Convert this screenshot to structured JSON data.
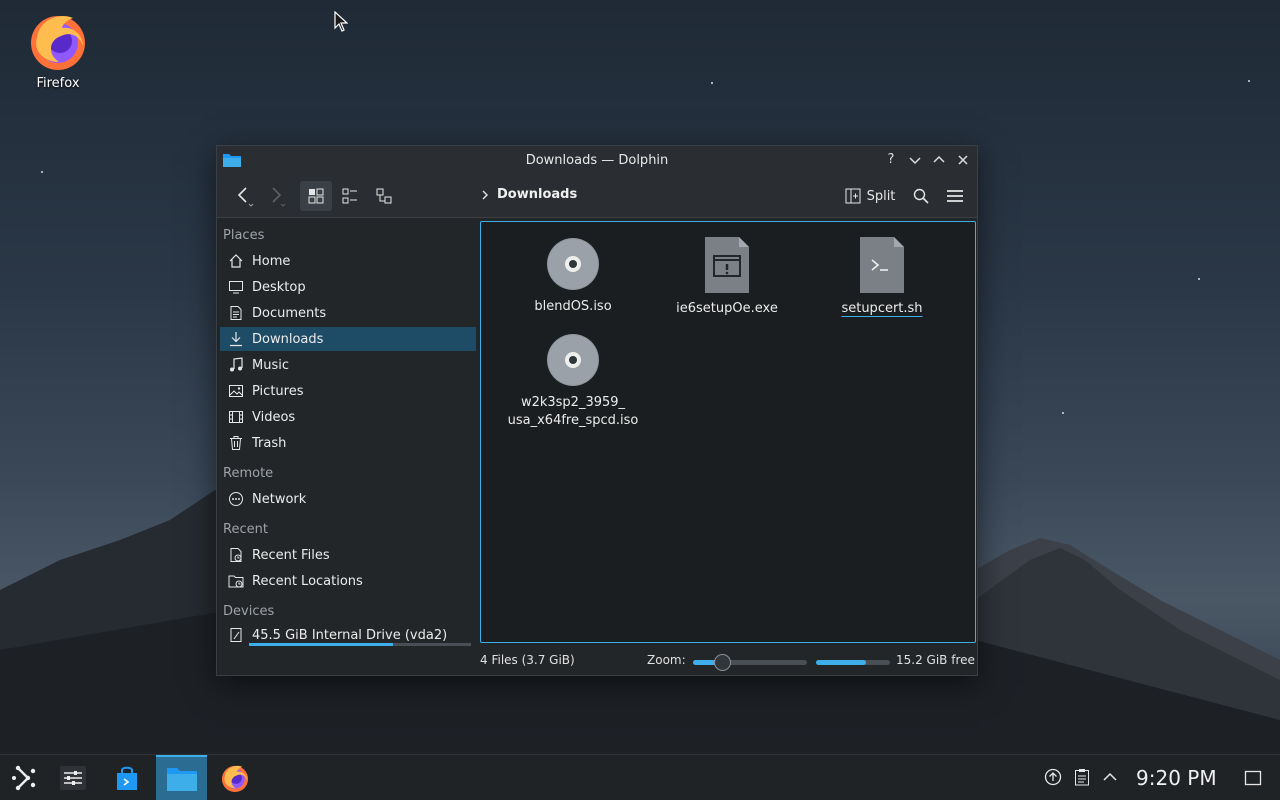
{
  "desktop": {
    "icons": [
      {
        "label": "Firefox",
        "icon": "firefox-icon"
      }
    ]
  },
  "window": {
    "title": "Downloads — Dolphin",
    "toolbar": {
      "breadcrumb": [
        "Downloads"
      ],
      "split_label": "Split"
    },
    "places": {
      "sections": {
        "places": "Places",
        "remote": "Remote",
        "recent": "Recent",
        "devices": "Devices"
      },
      "items": [
        {
          "label": "Home",
          "icon": "home-icon"
        },
        {
          "label": "Desktop",
          "icon": "desktop-icon"
        },
        {
          "label": "Documents",
          "icon": "documents-icon"
        },
        {
          "label": "Downloads",
          "icon": "downloads-icon",
          "selected": true
        },
        {
          "label": "Music",
          "icon": "music-icon"
        },
        {
          "label": "Pictures",
          "icon": "pictures-icon"
        },
        {
          "label": "Videos",
          "icon": "videos-icon"
        },
        {
          "label": "Trash",
          "icon": "trash-icon"
        }
      ],
      "remote_items": [
        {
          "label": "Network",
          "icon": "network-icon"
        }
      ],
      "recent_items": [
        {
          "label": "Recent Files",
          "icon": "recent-files-icon"
        },
        {
          "label": "Recent Locations",
          "icon": "recent-locations-icon"
        }
      ],
      "devices": [
        {
          "label": "45.5 GiB Internal Drive (vda2)",
          "icon": "drive-icon",
          "usage_fraction": 0.65
        }
      ]
    },
    "files": [
      {
        "name": "blendOS.iso",
        "icon": "disc-image-icon"
      },
      {
        "name": "ie6setupOe.exe",
        "icon": "executable-icon"
      },
      {
        "name": "setupcert.sh",
        "icon": "shell-script-icon"
      },
      {
        "name_line1": "w2k3sp2_3959_",
        "name_line2": "usa_x64fre_spcd.iso",
        "icon": "disc-image-icon"
      }
    ],
    "status": {
      "info": "4 Files (3.7 GiB)",
      "zoom_label": "Zoom:",
      "zoom_fraction": 0.25,
      "free_label": "15.2 GiB free",
      "free_used_fraction": 0.68
    }
  },
  "taskbar": {
    "clock": "9:20 PM",
    "colors": {
      "accent": "#3daee9",
      "active_task": "#2a6c92"
    }
  }
}
